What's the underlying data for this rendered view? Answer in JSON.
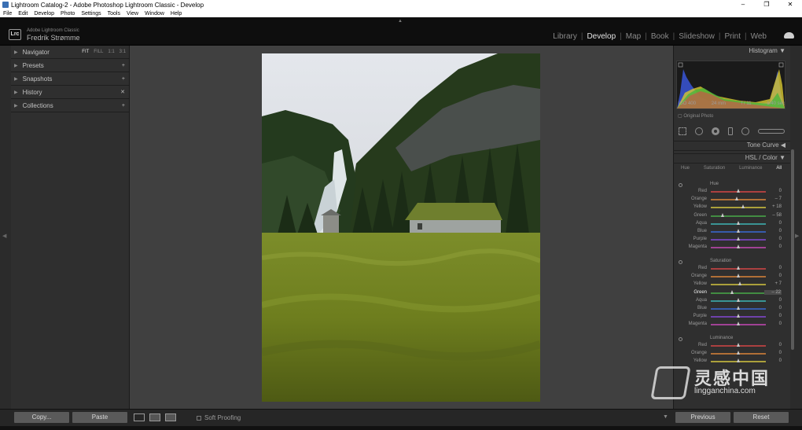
{
  "window": {
    "title": "Lightroom Catalog-2 - Adobe Photoshop Lightroom Classic - Develop",
    "minimize_icon": "–",
    "restore_icon": "❐",
    "close_icon": "✕"
  },
  "menu": [
    "File",
    "Edit",
    "Develop",
    "Photo",
    "Settings",
    "Tools",
    "View",
    "Window",
    "Help"
  ],
  "identity": {
    "logo": "Lrc",
    "app_name": "Adobe Lightroom Classic",
    "user_name": "Fredrik Strømme"
  },
  "modules": {
    "library": "Library",
    "develop": "Develop",
    "map": "Map",
    "book": "Book",
    "slideshow": "Slideshow",
    "print": "Print",
    "web": "Web",
    "separator": "|",
    "active": "Develop"
  },
  "left_panel": {
    "navigator": {
      "label": "Navigator",
      "fit": "FIT",
      "fill": "FILL",
      "one": "1:1",
      "three": "3:1"
    },
    "presets": {
      "label": "Presets",
      "action": "+"
    },
    "snapshots": {
      "label": "Snapshots",
      "action": "+"
    },
    "history": {
      "label": "History",
      "action": "✕"
    },
    "collections": {
      "label": "Collections",
      "action": "+"
    }
  },
  "histogram": {
    "title": "Histogram",
    "iso": "ISO 400",
    "focal": "24 mm",
    "aperture": "f / 11",
    "shutter": "1/40 sec",
    "original_photo": "Original Photo"
  },
  "tone_curve": {
    "title": "Tone Curve"
  },
  "hsl": {
    "title": "HSL / Color",
    "tabs": {
      "hue": "Hue",
      "saturation": "Saturation",
      "luminance": "Luminance",
      "all": "All"
    },
    "hue": {
      "label": "Hue",
      "rows": [
        {
          "name": "Red",
          "value": "0",
          "level": 0
        },
        {
          "name": "Orange",
          "value": "– 7",
          "level": -7
        },
        {
          "name": "Yellow",
          "value": "+ 18",
          "level": 18
        },
        {
          "name": "Green",
          "value": "– 58",
          "level": -58
        },
        {
          "name": "Aqua",
          "value": "0",
          "level": 0
        },
        {
          "name": "Blue",
          "value": "0",
          "level": 0
        },
        {
          "name": "Purple",
          "value": "0",
          "level": 0
        },
        {
          "name": "Magenta",
          "value": "0",
          "level": 0
        }
      ]
    },
    "saturation": {
      "label": "Saturation",
      "rows": [
        {
          "name": "Red",
          "value": "0",
          "level": 0
        },
        {
          "name": "Orange",
          "value": "0",
          "level": 0
        },
        {
          "name": "Yellow",
          "value": "+ 7",
          "level": 7
        },
        {
          "name": "Green",
          "value": "– 22",
          "level": -22
        },
        {
          "name": "Aqua",
          "value": "0",
          "level": 0
        },
        {
          "name": "Blue",
          "value": "0",
          "level": 0
        },
        {
          "name": "Purple",
          "value": "0",
          "level": 0
        },
        {
          "name": "Magenta",
          "value": "0",
          "level": 0
        }
      ]
    },
    "luminance": {
      "label": "Luminance",
      "rows": [
        {
          "name": "Red",
          "value": "0",
          "level": 0
        },
        {
          "name": "Orange",
          "value": "0",
          "level": 0
        },
        {
          "name": "Yellow",
          "value": "0",
          "level": 0
        }
      ]
    }
  },
  "bottom": {
    "copy": "Copy...",
    "paste": "Paste",
    "soft_proofing": "Soft Proofing",
    "previous": "Previous",
    "reset": "Reset"
  },
  "watermark": {
    "chinese": "灵感中国",
    "url": "lingganchina.com"
  },
  "colors": {
    "red": "#e04848",
    "orange": "#e88a3a",
    "yellow": "#e0d040",
    "green": "#4ab44a",
    "aqua": "#3fc0c0",
    "blue": "#3a6ee0",
    "purple": "#8a4ae0",
    "magenta": "#d04ac0"
  }
}
